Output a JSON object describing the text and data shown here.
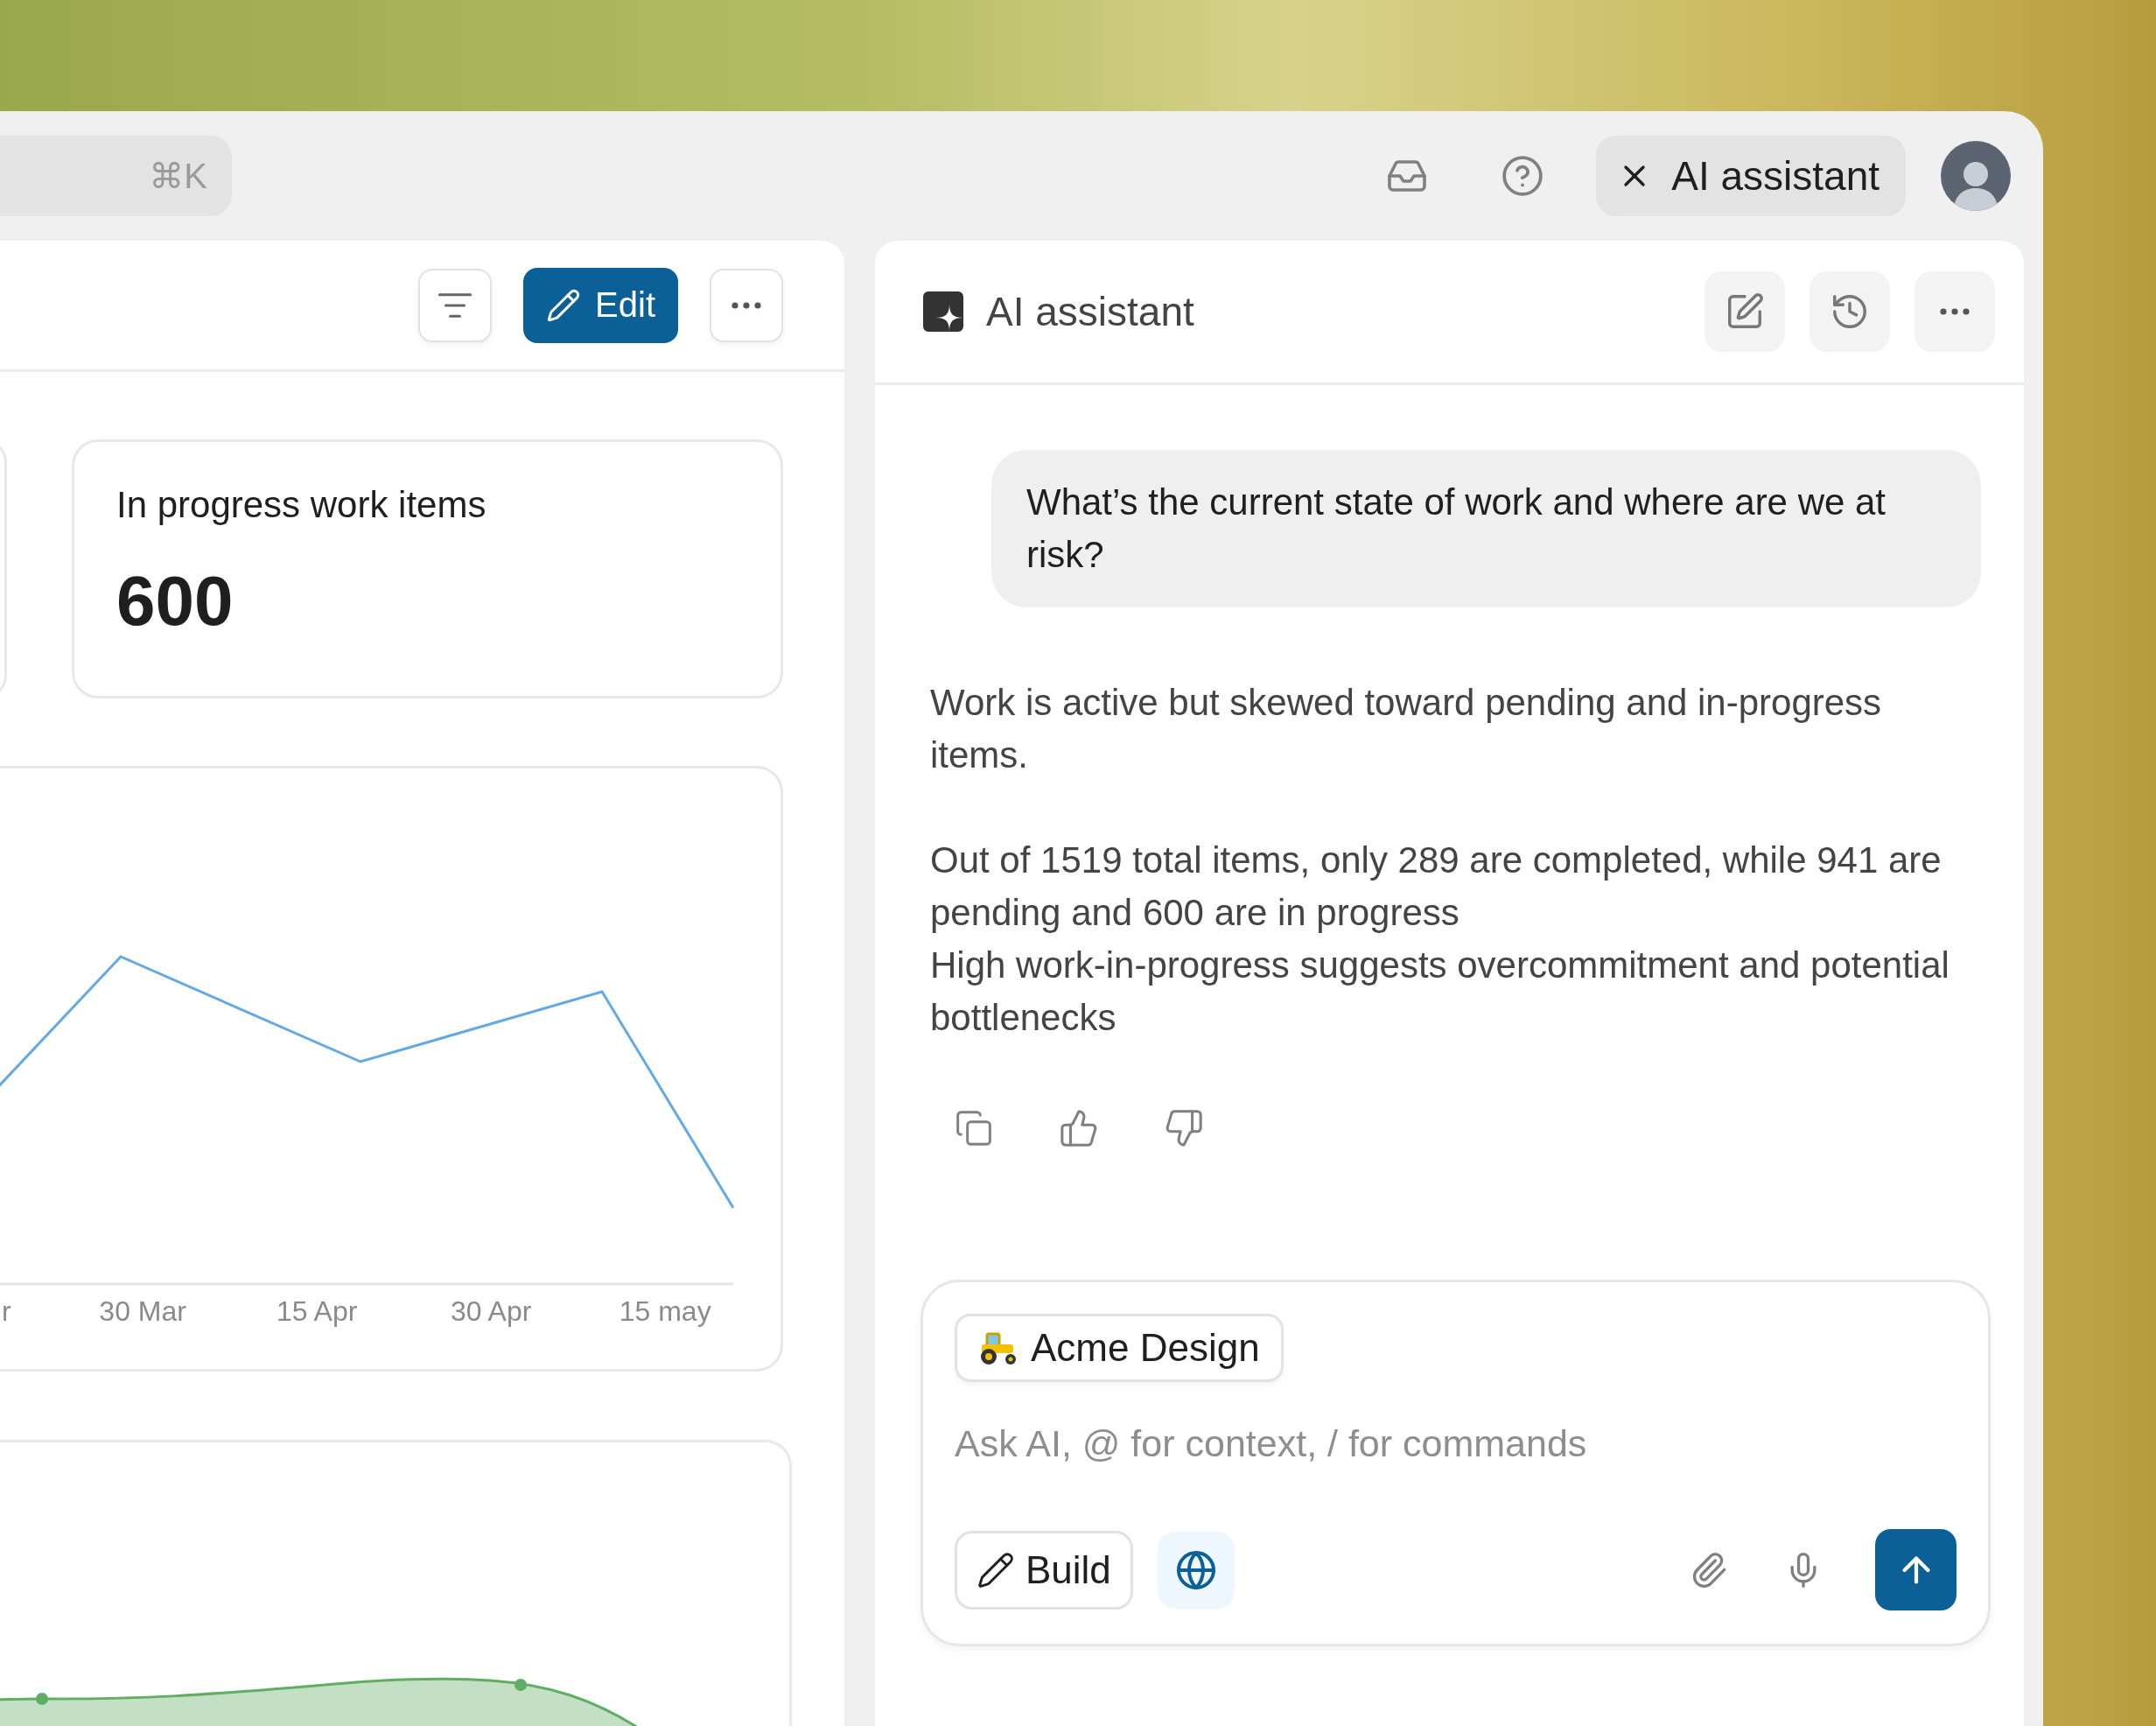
{
  "search": {
    "shortcut": "⌘K"
  },
  "topbar": {
    "assistant_toggle": {
      "label": "AI assistant"
    }
  },
  "dashboard": {
    "toolbar": {
      "edit_label": "Edit"
    },
    "stat_card": {
      "title": "In progress work items",
      "value": "600"
    },
    "line_chart": {
      "x_labels": [
        "r",
        "30 Mar",
        "15 Apr",
        "30 Apr",
        "15 may"
      ]
    }
  },
  "assistant": {
    "title": "AI assistant",
    "user_message": "What’s the current state of work and where are we at risk?",
    "response": [
      {
        "lines": [
          "Work is active but skewed toward pending and in-progress items."
        ]
      },
      {
        "lines": [
          "Out of 1519 total items, only 289 are completed, while 941 are pending and 600 are in progress",
          "High work-in-progress suggests overcommitment and potential bottlenecks"
        ]
      }
    ],
    "composer": {
      "context_chip": "Acme Design",
      "placeholder": "Ask AI, @ for context, / for commands",
      "build_label": "Build",
      "web_search_on": true
    }
  }
}
